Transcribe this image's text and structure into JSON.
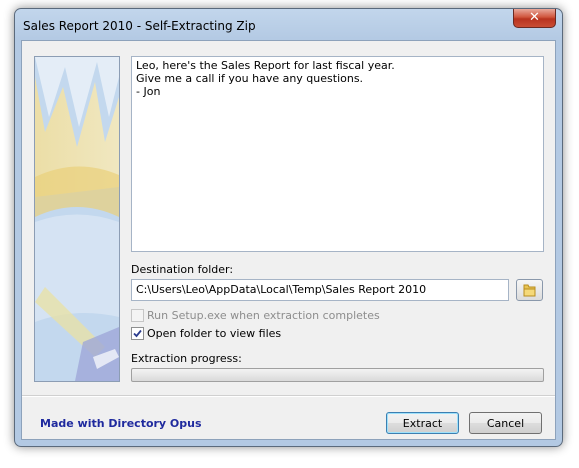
{
  "window": {
    "title": "Sales Report 2010 - Self-Extracting Zip",
    "close_glyph": "✕"
  },
  "message": {
    "lines": [
      "Leo, here's the Sales Report for last fiscal year.",
      "Give me a call if you have any questions.",
      "- Jon"
    ]
  },
  "destination": {
    "label": "Destination folder:",
    "value": "C:\\Users\\Leo\\AppData\\Local\\Temp\\Sales Report 2010",
    "browse_icon": "folder-icon"
  },
  "options": {
    "run_setup": {
      "label": "Run Setup.exe when extraction completes",
      "checked": false,
      "enabled": false
    },
    "open_folder": {
      "label": "Open folder to view files",
      "checked": true,
      "enabled": true
    }
  },
  "progress": {
    "label": "Extraction progress:",
    "value": 0
  },
  "footer": {
    "brand": "Made with Directory Opus",
    "extract_label": "Extract",
    "cancel_label": "Cancel"
  },
  "colors": {
    "brand_text": "#1f2a9e",
    "close_button": "#c94d34",
    "frame": "#b3c9e3"
  }
}
